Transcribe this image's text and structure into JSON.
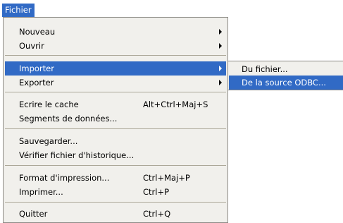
{
  "menubar": {
    "fichier_label": "Fichier"
  },
  "menu": {
    "nouveau": "Nouveau",
    "ouvrir": "Ouvrir",
    "importer": "Importer",
    "exporter": "Exporter",
    "ecrire_cache": "Ecrire le cache",
    "ecrire_cache_shortcut": "Alt+Ctrl+Maj+S",
    "segments": "Segments de données...",
    "sauvegarder": "Sauvegarder...",
    "verifier": "Vérifier fichier d'historique...",
    "format_impression": "Format d'impression...",
    "format_impression_shortcut": "Ctrl+Maj+P",
    "imprimer": "Imprimer...",
    "imprimer_shortcut": "Ctrl+P",
    "quitter": "Quitter",
    "quitter_shortcut": "Ctrl+Q"
  },
  "submenu": {
    "du_fichier": "Du fichier...",
    "source_odbc": "De la source ODBC..."
  },
  "colors": {
    "selection": "#316ac5",
    "menu_background": "#f1f0ec"
  },
  "icons": {
    "submenu_arrow": "chevron-right-icon"
  }
}
